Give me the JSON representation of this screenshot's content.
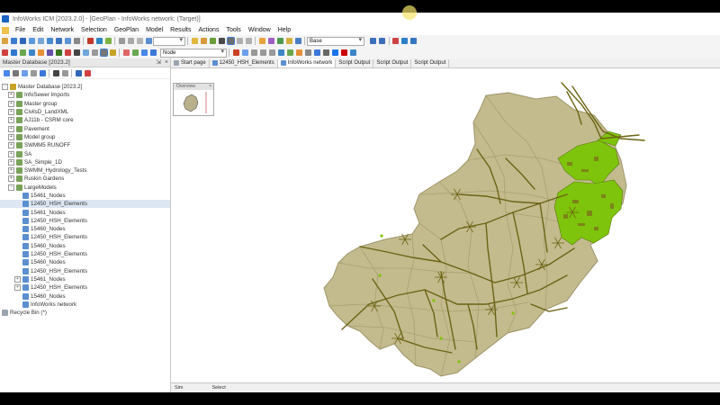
{
  "window": {
    "title": "InfoWorks ICM [2023.2.0] - [GeoPlan - InfoWorks network: (Target)]"
  },
  "menu": [
    "File",
    "Edit",
    "Network",
    "Selection",
    "GeoPlan",
    "Model",
    "Results",
    "Actions",
    "Tools",
    "Window",
    "Help"
  ],
  "toolbar": {
    "scenario_select": "Base",
    "layer_select": "Node"
  },
  "panel": {
    "title": "Master Database [2023.2]",
    "tree": [
      {
        "label": "Master Database [2023.2]",
        "level": 0,
        "icon": "database-icon",
        "expander": "-"
      },
      {
        "label": "InfoSewer Imports",
        "level": 1,
        "icon": "group-icon",
        "expander": "+"
      },
      {
        "label": "Master group",
        "level": 1,
        "icon": "group-icon",
        "expander": "+"
      },
      {
        "label": "CivilsD_LandXML",
        "level": 1,
        "icon": "group-icon",
        "expander": "+"
      },
      {
        "label": "AJ11b - CSRM core",
        "level": 1,
        "icon": "group-icon",
        "expander": "+"
      },
      {
        "label": "Pavement",
        "level": 1,
        "icon": "group-icon",
        "expander": "+"
      },
      {
        "label": "Model group",
        "level": 1,
        "icon": "group-icon",
        "expander": "+"
      },
      {
        "label": "SWMM5 RUNOFF",
        "level": 1,
        "icon": "group-icon",
        "expander": "+"
      },
      {
        "label": "SA",
        "level": 1,
        "icon": "group-icon",
        "expander": "+"
      },
      {
        "label": "SA_Simple_1D",
        "level": 1,
        "icon": "group-icon",
        "expander": "+"
      },
      {
        "label": "SWMM_Hydrology_Tests",
        "level": 1,
        "icon": "group-icon",
        "expander": "+"
      },
      {
        "label": "Ruskin Gardens",
        "level": 1,
        "icon": "group-icon",
        "expander": "+"
      },
      {
        "label": "LargeModels",
        "level": 1,
        "icon": "group-icon",
        "expander": "-"
      },
      {
        "label": "15461_Nodes",
        "level": 2,
        "icon": "network-icon",
        "expander": ""
      },
      {
        "label": "12450_HSH_Elements",
        "level": 2,
        "icon": "network-icon",
        "expander": "",
        "selected": true
      },
      {
        "label": "15461_Nodes",
        "level": 2,
        "icon": "network-icon",
        "expander": ""
      },
      {
        "label": "12450_HSH_Elements",
        "level": 2,
        "icon": "network-icon",
        "expander": ""
      },
      {
        "label": "15460_Nodes",
        "level": 2,
        "icon": "network-icon",
        "expander": ""
      },
      {
        "label": "12450_HSH_Elements",
        "level": 2,
        "icon": "network-icon",
        "expander": ""
      },
      {
        "label": "15460_Nodes",
        "level": 2,
        "icon": "network-icon",
        "expander": ""
      },
      {
        "label": "12450_HSH_Elements",
        "level": 2,
        "icon": "network-icon",
        "expander": ""
      },
      {
        "label": "15460_Nodes",
        "level": 2,
        "icon": "network-icon",
        "expander": ""
      },
      {
        "label": "12450_HSH_Elements",
        "level": 2,
        "icon": "network-icon",
        "expander": ""
      },
      {
        "label": "15461_Nodes",
        "level": 2,
        "icon": "network-icon",
        "expander": "+"
      },
      {
        "label": "12450_HSH_Elements",
        "level": 2,
        "icon": "network-icon",
        "expander": "+"
      },
      {
        "label": "15460_Nodes",
        "level": 2,
        "icon": "network-icon",
        "expander": ""
      },
      {
        "label": "InfoWorks network",
        "level": 2,
        "icon": "network-icon",
        "expander": ""
      },
      {
        "label": "Recycle Bin (*)",
        "level": 0,
        "icon": "recycle-bin-icon",
        "expander": ""
      }
    ]
  },
  "tabs": [
    {
      "label": "Start page"
    },
    {
      "label": "12450_HSH_Elements"
    },
    {
      "label": "InfoWorks network"
    },
    {
      "label": "Script Output"
    },
    {
      "label": "Script Output"
    },
    {
      "label": "Script Output"
    }
  ],
  "overview": {
    "title": "Overview"
  },
  "statusbar": {
    "left": "Sim",
    "right": "Select"
  },
  "colors": {
    "catchment_fill": "#c3bb8d",
    "catchment_border": "#9e9569",
    "pipe": "#6b6414",
    "highlight": "#7fc40c"
  }
}
